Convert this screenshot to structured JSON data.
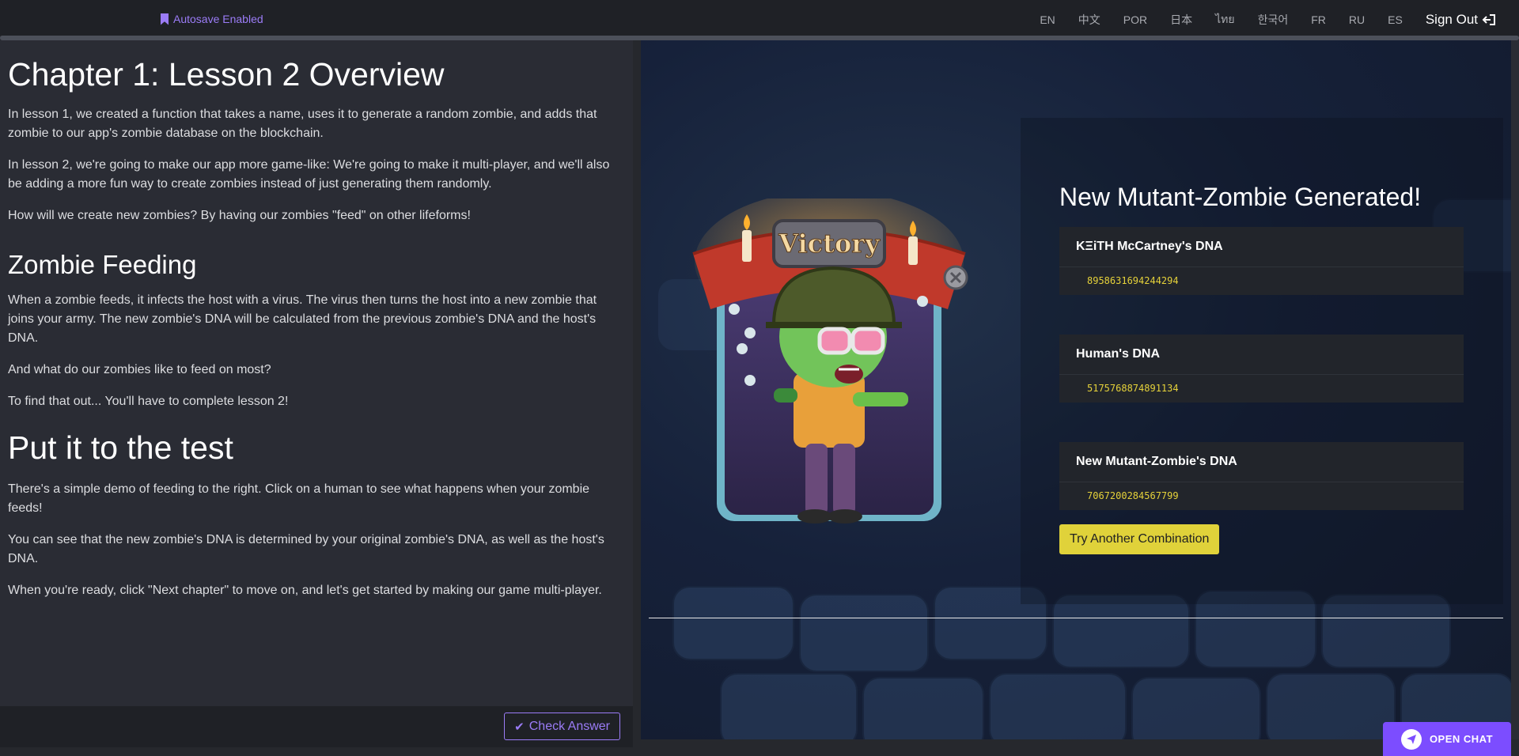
{
  "topbar": {
    "autosave_label": "Autosave Enabled",
    "languages": [
      "EN",
      "中文",
      "POR",
      "日本",
      "ไทย",
      "한국어",
      "FR",
      "RU",
      "ES"
    ],
    "signout_label": "Sign Out"
  },
  "lesson": {
    "title": "Chapter 1: Lesson 2 Overview",
    "intro_p1": "In lesson 1, we created a function that takes a name, uses it to generate a random zombie, and adds that zombie to our app's zombie database on the blockchain.",
    "intro_p2": "In lesson 2, we're going to make our app more game-like: We're going to make it multi-player, and we'll also be adding a more fun way to create zombies instead of just generating them randomly.",
    "intro_p3": "How will we create new zombies? By having our zombies \"feed\" on other lifeforms!",
    "feeding_heading": "Zombie Feeding",
    "feeding_p1": "When a zombie feeds, it infects the host with a virus. The virus then turns the host into a new zombie that joins your army. The new zombie's DNA will be calculated from the previous zombie's DNA and the host's DNA.",
    "feeding_p2": "And what do our zombies like to feed on most?",
    "feeding_p3": "To find that out... You'll have to complete lesson 2!",
    "test_heading": "Put it to the test",
    "test_p1": "There's a simple demo of feeding to the right. Click on a human to see what happens when your zombie feeds!",
    "test_p2": "You can see that the new zombie's DNA is determined by your original zombie's DNA, as well as the host's DNA.",
    "test_p3": "When you're ready, click \"Next chapter\" to move on, and let's get started by making our game multi-player."
  },
  "check_answer_label": "Check Answer",
  "demo": {
    "victory_label": "Victory",
    "result_title": "New Mutant-Zombie Generated!",
    "cards": [
      {
        "name": "KΞiTH McCartney's DNA",
        "dna": "8958631694244294"
      },
      {
        "name": "Human's DNA",
        "dna": "5175768874891134"
      },
      {
        "name": "New Mutant-Zombie's DNA",
        "dna": "7067200284567799"
      }
    ],
    "try_label": "Try Another Combination"
  },
  "chat": {
    "label": "OPEN CHAT"
  },
  "colors": {
    "accent": "#9b7cf7",
    "dna_yellow": "#e6d23a",
    "button_yellow": "#e0d23a",
    "chat_purple": "#7c4dff"
  }
}
